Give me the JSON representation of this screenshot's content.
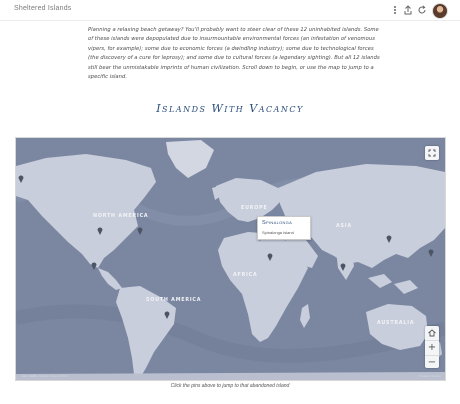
{
  "header": {
    "title": "Sheltered Islands",
    "icons": [
      "kebab-menu-icon",
      "share-icon",
      "refresh-icon"
    ]
  },
  "intro": {
    "text": "Planning a relaxing beach getaway? You'll probably want to steer clear of these 12 uninhabited islands. Some of these islands were depopulated due to insurmountable environmental forces (an infestation of venomous vipers, for example); some due to economic forces (a dwindling industry); some due to technological forces (the discovery of a cure for leprosy); and some due to cultural forces (a legendary sighting). But all 12 islands still bear the unmistakable imprints of human civilization. Scroll down to begin, or use the map to jump to a specific island."
  },
  "heading": "Islands With Vacancy",
  "map": {
    "labels": {
      "north_america": "NORTH AMERICA",
      "south_america": "SOUTH AMERICA",
      "europe": "EUROPE",
      "africa": "AFRICA",
      "asia": "ASIA",
      "australia": "AUSTRALIA"
    },
    "tooltip": {
      "name": "Spinalonga",
      "sub": "Spinalonga Island"
    },
    "zoom_in": "+",
    "zoom_out": "−",
    "attribution": "Esri, HERE, Garmin, NGA, USGS",
    "info": "Powered by Esri",
    "colors": {
      "land": "#c9cedc",
      "ocean": "#7b87a1",
      "pin": "#4b5566",
      "active_pin": "#2c4f7c"
    }
  },
  "caption": "Click the pins above to jump to that abandoned island"
}
